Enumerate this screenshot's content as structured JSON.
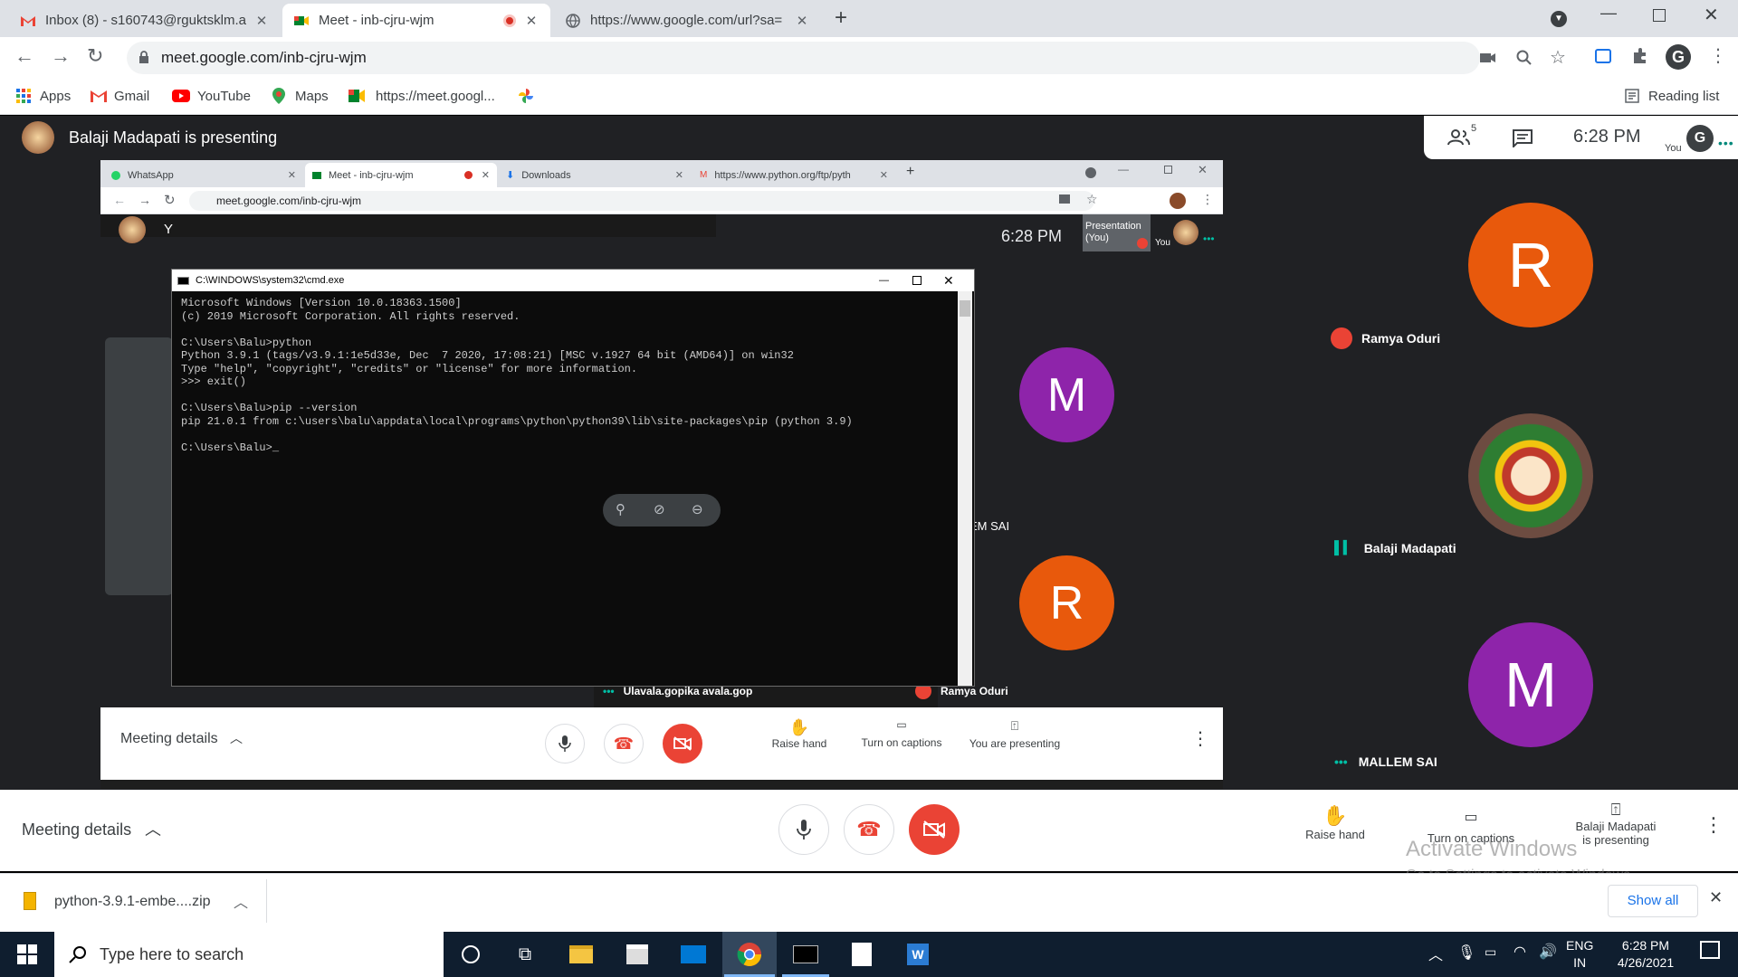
{
  "browser": {
    "tabs": [
      {
        "title": "Inbox (8) - s160743@rguktsklm.a"
      },
      {
        "title": "Meet - inb-cjru-wjm"
      },
      {
        "title": "https://www.google.com/url?sa="
      }
    ],
    "url": "meet.google.com/inb-cjru-wjm",
    "bookmarks": [
      "Apps",
      "Gmail",
      "YouTube",
      "Maps",
      "https://meet.googl..."
    ],
    "reading_list": "Reading list",
    "new_tab_icon": "+"
  },
  "meet": {
    "presenting_banner": "Balaji Madapati is presenting",
    "participant_count": "5",
    "clock": "6:28 PM",
    "you_label": "You",
    "participants": [
      {
        "initial": "R",
        "name": "Ramya Oduri",
        "color": "#e8590c",
        "muted": true
      },
      {
        "initial": "",
        "name": "Balaji Madapati",
        "color": "#c8a070",
        "muted": false
      },
      {
        "initial": "M",
        "name": "MALLEM SAI",
        "color": "#8e24aa",
        "muted": false
      }
    ],
    "bottom": {
      "meeting_details": "Meeting details",
      "raise_hand": "Raise hand",
      "captions": "Turn on captions",
      "presenting_line1": "Balaji Madapati",
      "presenting_line2": "is presenting"
    },
    "watermark": {
      "line1": "Activate Windows",
      "line2": "Go to Settings to activate Windows."
    }
  },
  "inner_screen": {
    "tabs": [
      "WhatsApp",
      "Meet - inb-cjru-wjm",
      "Downloads",
      "https://www.python.org/ftp/pyth"
    ],
    "url": "meet.google.com/inb-cjru-wjm",
    "clock": "6:28 PM",
    "presentation_label_1": "Presentation",
    "presentation_label_2": "(You)",
    "you_label": "You",
    "partial_name": "Y",
    "cut_name": "EM SAI",
    "tiles": [
      {
        "initial": "M",
        "color": "#8e24aa"
      },
      {
        "initial": "R",
        "color": "#e8590c"
      }
    ],
    "names": [
      "Ulavala.gopika avala.gop",
      "Ramya Oduri"
    ],
    "bottom": {
      "meeting_details": "Meeting details",
      "raise_hand": "Raise hand",
      "captions": "Turn on captions",
      "presenting": "You are presenting"
    },
    "cmd": {
      "title": "C:\\WINDOWS\\system32\\cmd.exe",
      "lines": [
        "Microsoft Windows [Version 10.0.18363.1500]",
        "(c) 2019 Microsoft Corporation. All rights reserved.",
        "",
        "C:\\Users\\Balu>python",
        "Python 3.9.1 (tags/v3.9.1:1e5d33e, Dec  7 2020, 17:08:21) [MSC v.1927 64 bit (AMD64)] on win32",
        "Type \"help\", \"copyright\", \"credits\" or \"license\" for more information.",
        ">>> exit()",
        "",
        "C:\\Users\\Balu>pip --version",
        "pip 21.0.1 from c:\\users\\balu\\appdata\\local\\programs\\python\\python39\\lib\\site-packages\\pip (python 3.9)",
        "",
        "C:\\Users\\Balu>_"
      ]
    }
  },
  "downloads": {
    "file": "python-3.9.1-embe....zip",
    "show_all": "Show all"
  },
  "taskbar": {
    "search_placeholder": "Type here to search",
    "lang1": "ENG",
    "lang2": "IN",
    "time": "6:28 PM",
    "date": "4/26/2021"
  }
}
